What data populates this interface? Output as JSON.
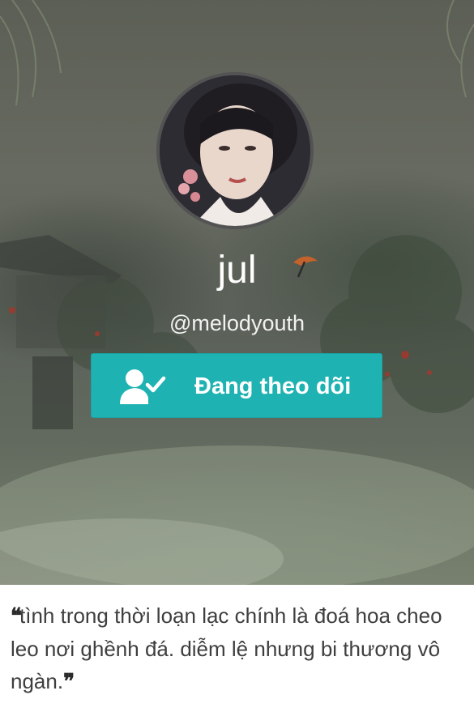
{
  "profile": {
    "display_name": "jul",
    "username": "@melodyouth",
    "follow_button": {
      "label": "Đang theo dõi",
      "icon": "user-check-icon",
      "color": "#1fb2b2"
    },
    "name_decoration_icon": "paper-umbrella-icon",
    "avatar_icon": "profile-photo"
  },
  "bio": {
    "open_quote": "❝",
    "text": "tình trong thời loạn lạc chính là đoá hoa cheo leo nơi ghềnh đá. diễm lệ nhưng bi thương vô ngàn.",
    "close_quote": "❞"
  }
}
